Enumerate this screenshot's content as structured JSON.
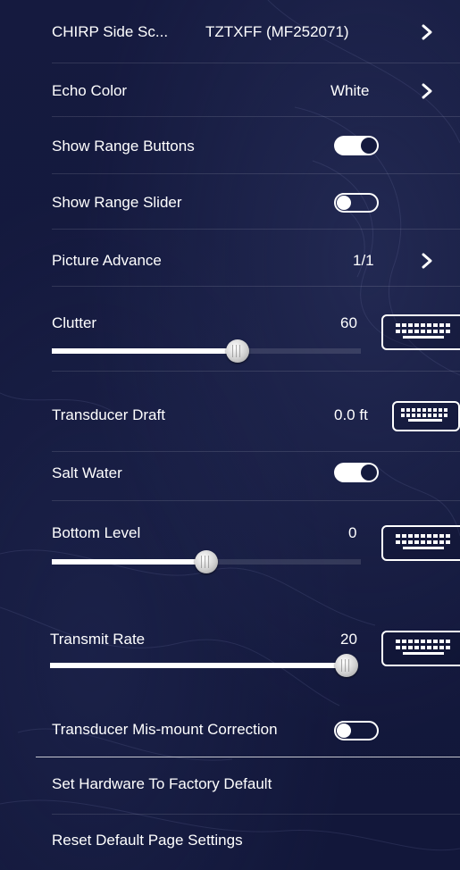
{
  "rows": {
    "chirp_side_scan": {
      "label": "CHIRP Side Sc...",
      "value": "TZTXFF (MF252071)"
    },
    "echo_color": {
      "label": "Echo Color",
      "value": "White"
    },
    "show_range_buttons": {
      "label": "Show Range Buttons",
      "state": "on"
    },
    "show_range_slider": {
      "label": "Show Range Slider",
      "state": "off"
    },
    "picture_advance": {
      "label": "Picture Advance",
      "value": "1/1"
    },
    "clutter": {
      "label": "Clutter",
      "value": "60",
      "level": 0.6
    },
    "transducer_draft": {
      "label": "Transducer Draft",
      "value": "0.0 ft"
    },
    "salt_water": {
      "label": "Salt Water",
      "state": "on"
    },
    "bottom_level": {
      "label": "Bottom Level",
      "value": "0",
      "level": 0.5
    },
    "transmit_rate": {
      "label": "Transmit Rate",
      "value": "20",
      "level": 1.0
    },
    "transducer_mismount": {
      "label": "Transducer Mis-mount Correction",
      "state": "off"
    },
    "factory_default": {
      "label": "Set Hardware To Factory Default"
    },
    "reset_page_settings": {
      "label": "Reset Default Page Settings"
    }
  },
  "icons": {
    "chevron": "chevron-right-icon",
    "keyboard": "keyboard-icon"
  },
  "colors": {
    "background": "#141a3e",
    "text": "#ffffff",
    "slider_fill": "#ffffff"
  }
}
